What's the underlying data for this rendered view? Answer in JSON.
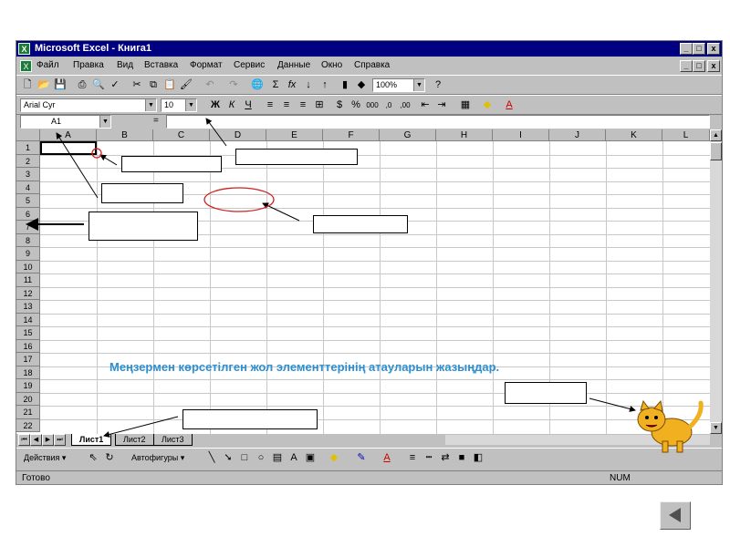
{
  "window": {
    "title": "Microsoft Excel - Книга1",
    "controls": [
      "_",
      "□",
      "x"
    ],
    "doc_controls": [
      "_",
      "□",
      "x"
    ]
  },
  "menu": [
    "Файл",
    "Правка",
    "Вид",
    "Вставка",
    "Формат",
    "Сервис",
    "Данные",
    "Окно",
    "Справка"
  ],
  "standard_toolbar": {
    "zoom": "100%",
    "help": "?"
  },
  "format_toolbar": {
    "font": "Arial Cyr",
    "size": "10"
  },
  "formula_bar": {
    "cell_ref": "A1",
    "equals": "=",
    "formula": ""
  },
  "grid": {
    "columns": [
      "A",
      "B",
      "C",
      "D",
      "E",
      "F",
      "G",
      "H",
      "I",
      "J",
      "K",
      "L"
    ],
    "rows": [
      "1",
      "2",
      "3",
      "4",
      "5",
      "6",
      "7",
      "8",
      "9",
      "10",
      "11",
      "12",
      "13",
      "14",
      "15",
      "16",
      "17",
      "18",
      "19",
      "20",
      "21",
      "22"
    ]
  },
  "sheet_tabs": [
    "Лист1",
    "Лист2",
    "Лист3"
  ],
  "drawing_toolbar": {
    "draw": "Действия ▾",
    "autoshapes": "Автофигуры ▾"
  },
  "status": {
    "ready": "Готово",
    "num": "NUM"
  },
  "caption": "Меңзермен көрсетілген жол элементтерінің атауларын жазыңдар.",
  "colors": {
    "title_bar": "#000080",
    "caption": "#2e8fd0",
    "face": "#c0c0c0"
  }
}
